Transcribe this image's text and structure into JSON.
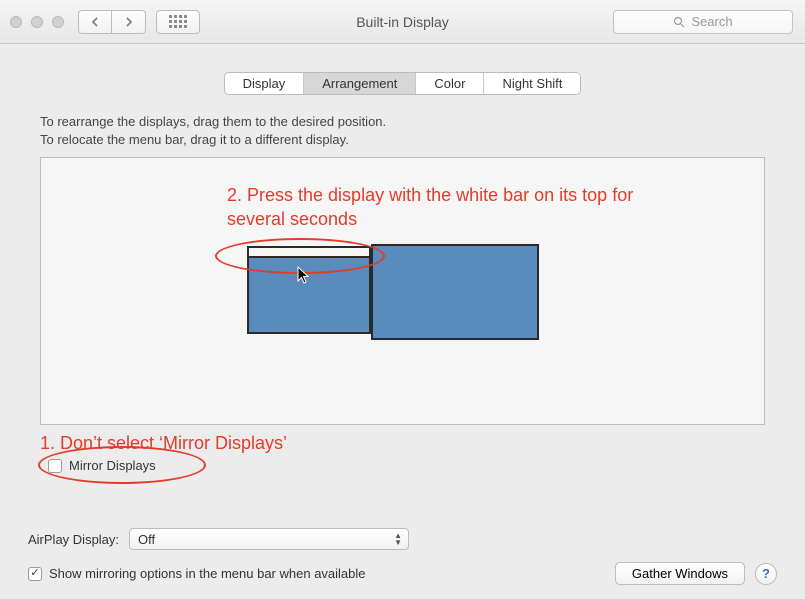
{
  "window": {
    "title": "Built-in Display",
    "search_placeholder": "Search"
  },
  "tabs": {
    "display": "Display",
    "arrangement": "Arrangement",
    "color": "Color",
    "night_shift": "Night Shift"
  },
  "instructions": {
    "line1": "To rearrange the displays, drag them to the desired position.",
    "line2": "To relocate the menu bar, drag it to a different display."
  },
  "annotations": {
    "a1": "1. Don’t select ‘Mirror Displays’",
    "a2": "2. Press the display with the white bar on its top for several seconds"
  },
  "mirror": {
    "label": "Mirror Displays",
    "checked": false
  },
  "airplay": {
    "label": "AirPlay Display:",
    "value": "Off"
  },
  "show_mirroring": {
    "label": "Show mirroring options in the menu bar when available",
    "checked": true
  },
  "buttons": {
    "gather": "Gather Windows",
    "help": "?"
  }
}
